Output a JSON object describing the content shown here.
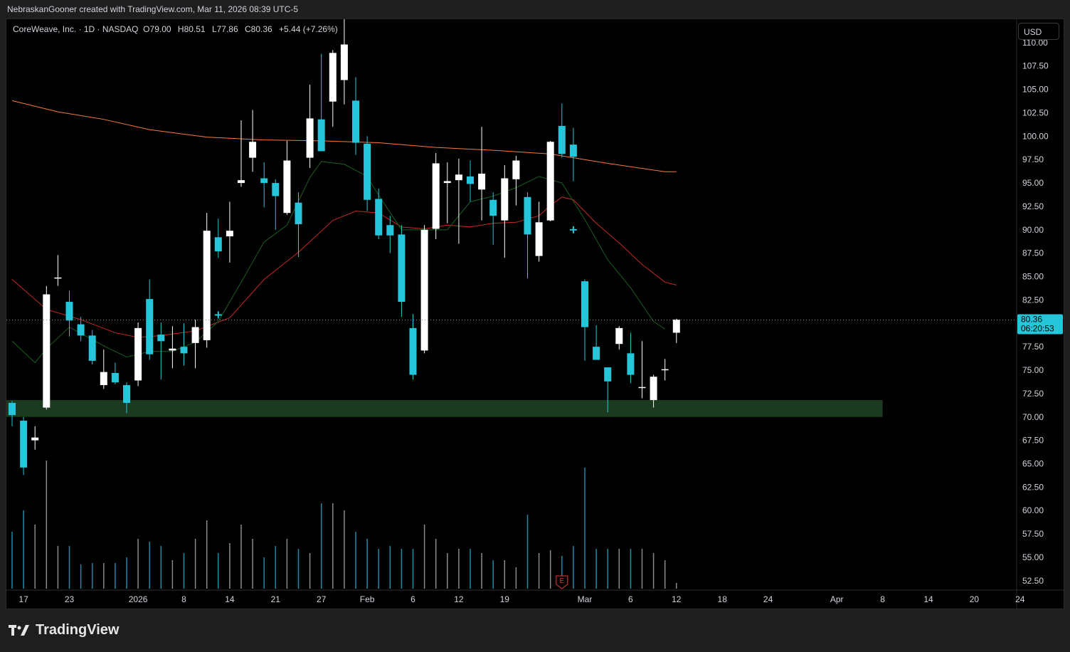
{
  "header": {
    "attribution": "NebraskanGooner created with TradingView.com, Mar 11, 2026 08:39 UTC-5"
  },
  "legend": {
    "symbol": "CoreWeave, Inc. · 1D · NASDAQ",
    "open_label": "O",
    "open": "79.00",
    "high_label": "H",
    "high": "80.51",
    "low_label": "L",
    "low": "77.86",
    "close_label": "C",
    "close": "80.36",
    "change": "+5.44 (+7.26%)"
  },
  "currency": "USD",
  "price_tag": {
    "price": "80.36",
    "countdown": "06:20:53"
  },
  "footer": {
    "brand": "TradingView"
  },
  "colors": {
    "up": "#ffffff",
    "down": "#26c6da",
    "ma_long": "#f57c3a",
    "ma_mid": "#c62828",
    "ma_short": "#1b5e20",
    "zone": "#1b3a1f"
  },
  "chart_data": {
    "type": "candlestick",
    "ylim": [
      51.5,
      112.5
    ],
    "y_ticks": [
      "110.00",
      "107.50",
      "105.00",
      "102.50",
      "100.00",
      "97.50",
      "95.00",
      "92.50",
      "90.00",
      "87.50",
      "85.00",
      "82.50",
      "80.00",
      "77.50",
      "75.00",
      "72.50",
      "70.00",
      "67.50",
      "65.00",
      "62.50",
      "60.00",
      "57.50",
      "55.00",
      "52.50"
    ],
    "x_ticks": [
      {
        "label": "17",
        "i": 1
      },
      {
        "label": "23",
        "i": 5
      },
      {
        "label": "2026",
        "i": 11
      },
      {
        "label": "8",
        "i": 15
      },
      {
        "label": "14",
        "i": 19
      },
      {
        "label": "21",
        "i": 23
      },
      {
        "label": "27",
        "i": 27
      },
      {
        "label": "Feb",
        "i": 31
      },
      {
        "label": "6",
        "i": 35
      },
      {
        "label": "12",
        "i": 39
      },
      {
        "label": "19",
        "i": 43
      },
      {
        "label": "Mar",
        "i": 50
      },
      {
        "label": "6",
        "i": 54
      },
      {
        "label": "12",
        "i": 58
      },
      {
        "label": "18",
        "i": 62
      },
      {
        "label": "24",
        "i": 66
      },
      {
        "label": "Apr",
        "i": 72
      },
      {
        "label": "8",
        "i": 76
      },
      {
        "label": "14",
        "i": 80
      },
      {
        "label": "20",
        "i": 84
      },
      {
        "label": "24",
        "i": 88
      }
    ],
    "candles": [
      {
        "o": 71.5,
        "h": 71.7,
        "l": 69.0,
        "c": 70.2,
        "v": 0.4
      },
      {
        "o": 69.6,
        "h": 70.0,
        "l": 63.8,
        "c": 64.6,
        "v": 0.55
      },
      {
        "o": 67.5,
        "h": 69.0,
        "l": 66.5,
        "c": 67.8,
        "v": 0.45
      },
      {
        "o": 71.0,
        "h": 84.0,
        "l": 70.8,
        "c": 83.1,
        "v": 0.9
      },
      {
        "o": 84.8,
        "h": 87.3,
        "l": 84.0,
        "c": 84.9,
        "v": 0.3
      },
      {
        "o": 82.3,
        "h": 83.5,
        "l": 78.6,
        "c": 80.3,
        "v": 0.3
      },
      {
        "o": 79.9,
        "h": 80.7,
        "l": 78.1,
        "c": 78.7,
        "v": 0.17
      },
      {
        "o": 78.7,
        "h": 79.3,
        "l": 75.6,
        "c": 76.0,
        "v": 0.18
      },
      {
        "o": 73.4,
        "h": 77.2,
        "l": 73.0,
        "c": 74.8,
        "v": 0.18
      },
      {
        "o": 74.7,
        "h": 75.8,
        "l": 73.5,
        "c": 73.7,
        "v": 0.18
      },
      {
        "o": 73.4,
        "h": 73.7,
        "l": 70.4,
        "c": 71.5,
        "v": 0.22
      },
      {
        "o": 73.9,
        "h": 80.1,
        "l": 73.3,
        "c": 79.5,
        "v": 0.35
      },
      {
        "o": 82.6,
        "h": 84.7,
        "l": 76.1,
        "c": 76.7,
        "v": 0.33
      },
      {
        "o": 78.8,
        "h": 80.1,
        "l": 74.0,
        "c": 78.1,
        "v": 0.3
      },
      {
        "o": 77.1,
        "h": 79.7,
        "l": 75.2,
        "c": 77.3,
        "v": 0.2
      },
      {
        "o": 77.5,
        "h": 80.0,
        "l": 75.5,
        "c": 76.8,
        "v": 0.25
      },
      {
        "o": 77.9,
        "h": 80.4,
        "l": 75.2,
        "c": 79.6,
        "v": 0.35
      },
      {
        "o": 78.2,
        "h": 91.8,
        "l": 77.4,
        "c": 89.9,
        "v": 0.48
      },
      {
        "o": 89.2,
        "h": 91.2,
        "l": 87.0,
        "c": 87.7,
        "v": 0.25
      },
      {
        "o": 89.3,
        "h": 93.0,
        "l": 86.5,
        "c": 89.9,
        "v": 0.32
      },
      {
        "o": 95.0,
        "h": 101.7,
        "l": 94.6,
        "c": 95.3,
        "v": 0.45
      },
      {
        "o": 97.7,
        "h": 102.8,
        "l": 96.2,
        "c": 99.4,
        "v": 0.35
      },
      {
        "o": 95.5,
        "h": 97.2,
        "l": 92.4,
        "c": 95.0,
        "v": 0.22
      },
      {
        "o": 95.0,
        "h": 95.4,
        "l": 90.0,
        "c": 93.6,
        "v": 0.3
      },
      {
        "o": 91.8,
        "h": 99.5,
        "l": 91.6,
        "c": 97.4,
        "v": 0.35
      },
      {
        "o": 92.9,
        "h": 94.0,
        "l": 87.1,
        "c": 90.6,
        "v": 0.28
      },
      {
        "o": 97.7,
        "h": 105.5,
        "l": 96.6,
        "c": 101.9,
        "v": 0.25
      },
      {
        "o": 101.8,
        "h": 108.8,
        "l": 98.4,
        "c": 98.4,
        "v": 0.6
      },
      {
        "o": 103.7,
        "h": 109.2,
        "l": 101.0,
        "c": 108.9,
        "v": 0.6
      },
      {
        "o": 106.0,
        "h": 115.0,
        "l": 103.4,
        "c": 109.8,
        "v": 0.55
      },
      {
        "o": 103.8,
        "h": 106.3,
        "l": 98.0,
        "c": 99.3,
        "v": 0.4
      },
      {
        "o": 99.2,
        "h": 100.0,
        "l": 92.0,
        "c": 93.2,
        "v": 0.35
      },
      {
        "o": 93.3,
        "h": 94.4,
        "l": 89.0,
        "c": 89.4,
        "v": 0.28
      },
      {
        "o": 90.5,
        "h": 91.5,
        "l": 87.5,
        "c": 89.4,
        "v": 0.3
      },
      {
        "o": 89.5,
        "h": 90.5,
        "l": 80.7,
        "c": 82.3,
        "v": 0.28
      },
      {
        "o": 79.5,
        "h": 81.0,
        "l": 74.0,
        "c": 74.5,
        "v": 0.28
      },
      {
        "o": 77.1,
        "h": 90.5,
        "l": 76.8,
        "c": 90.0,
        "v": 0.45
      },
      {
        "o": 90.1,
        "h": 98.2,
        "l": 89.0,
        "c": 97.1,
        "v": 0.35
      },
      {
        "o": 95.0,
        "h": 97.2,
        "l": 90.7,
        "c": 95.2,
        "v": 0.25
      },
      {
        "o": 95.3,
        "h": 97.6,
        "l": 88.5,
        "c": 95.9,
        "v": 0.28
      },
      {
        "o": 95.7,
        "h": 97.4,
        "l": 93.0,
        "c": 94.9,
        "v": 0.28
      },
      {
        "o": 94.3,
        "h": 101.0,
        "l": 91.0,
        "c": 96.0,
        "v": 0.25
      },
      {
        "o": 93.2,
        "h": 94.0,
        "l": 88.4,
        "c": 91.5,
        "v": 0.2
      },
      {
        "o": 91.0,
        "h": 96.9,
        "l": 87.0,
        "c": 95.5,
        "v": 0.2
      },
      {
        "o": 95.4,
        "h": 97.9,
        "l": 92.6,
        "c": 97.4,
        "v": 0.15
      },
      {
        "o": 93.5,
        "h": 94.0,
        "l": 84.8,
        "c": 89.5,
        "v": 0.52
      },
      {
        "o": 87.2,
        "h": 93.0,
        "l": 86.6,
        "c": 90.8,
        "v": 0.25
      },
      {
        "o": 91.0,
        "h": 99.5,
        "l": 90.9,
        "c": 99.4,
        "v": 0.27
      },
      {
        "o": 101.1,
        "h": 103.5,
        "l": 97.7,
        "c": 98.1,
        "v": 0.23
      },
      {
        "o": 99.1,
        "h": 100.9,
        "l": 95.2,
        "c": 97.8,
        "v": 0.3
      },
      {
        "o": 84.5,
        "h": 84.7,
        "l": 76.0,
        "c": 79.6,
        "v": 0.85
      },
      {
        "o": 77.5,
        "h": 79.8,
        "l": 76.2,
        "c": 76.1,
        "v": 0.28
      },
      {
        "o": 75.3,
        "h": 75.3,
        "l": 70.5,
        "c": 73.8,
        "v": 0.28
      },
      {
        "o": 77.8,
        "h": 79.7,
        "l": 77.2,
        "c": 79.5,
        "v": 0.28
      },
      {
        "o": 76.8,
        "h": 79.0,
        "l": 73.6,
        "c": 74.5,
        "v": 0.28
      },
      {
        "o": 73.2,
        "h": 78.1,
        "l": 72.0,
        "c": 73.2,
        "v": 0.28
      },
      {
        "o": 71.8,
        "h": 74.5,
        "l": 71.0,
        "c": 74.3,
        "v": 0.25
      },
      {
        "o": 75.0,
        "h": 76.2,
        "l": 73.9,
        "c": 75.1,
        "v": 0.2
      },
      {
        "o": 79.0,
        "h": 80.5,
        "l": 77.9,
        "c": 80.4,
        "v": 0.04
      }
    ],
    "ma_long": [
      [
        0,
        103.8
      ],
      [
        4,
        102.6
      ],
      [
        8,
        101.8
      ],
      [
        12,
        100.7
      ],
      [
        17,
        99.9
      ],
      [
        22,
        99.6
      ],
      [
        27,
        99.5
      ],
      [
        32,
        99.3
      ],
      [
        37,
        98.8
      ],
      [
        42,
        98.5
      ],
      [
        47,
        98.1
      ],
      [
        52,
        97.1
      ],
      [
        57,
        96.2
      ],
      [
        58,
        96.2
      ]
    ],
    "ma_mid": [
      [
        0,
        84.7
      ],
      [
        3,
        81.5
      ],
      [
        6,
        80.4
      ],
      [
        9,
        79.0
      ],
      [
        11,
        78.5
      ],
      [
        13,
        78.7
      ],
      [
        16,
        79.2
      ],
      [
        19,
        80.6
      ],
      [
        22,
        84.7
      ],
      [
        25,
        87.6
      ],
      [
        28,
        91.0
      ],
      [
        30,
        92.0
      ],
      [
        32,
        91.8
      ],
      [
        34,
        90.3
      ],
      [
        36,
        90.1
      ],
      [
        38,
        90.5
      ],
      [
        40,
        90.3
      ],
      [
        42,
        90.7
      ],
      [
        44,
        90.8
      ],
      [
        46,
        91.5
      ],
      [
        47,
        92.6
      ],
      [
        48,
        93.5
      ],
      [
        49,
        93.2
      ],
      [
        51,
        90.7
      ],
      [
        53,
        88.6
      ],
      [
        55,
        86.3
      ],
      [
        57,
        84.4
      ],
      [
        58,
        84.1
      ]
    ],
    "ma_short": [
      [
        0,
        78.1
      ],
      [
        2,
        75.8
      ],
      [
        3,
        77.3
      ],
      [
        5,
        79.6
      ],
      [
        8,
        77.6
      ],
      [
        10,
        76.4
      ],
      [
        12,
        77.0
      ],
      [
        14,
        77.0
      ],
      [
        16,
        78.0
      ],
      [
        18,
        80.2
      ],
      [
        20,
        84.4
      ],
      [
        22,
        88.7
      ],
      [
        24,
        90.5
      ],
      [
        26,
        95.6
      ],
      [
        27,
        97.3
      ],
      [
        29,
        97.0
      ],
      [
        31,
        95.7
      ],
      [
        32,
        93.7
      ],
      [
        34,
        90.0
      ],
      [
        36,
        90.0
      ],
      [
        38,
        90.0
      ],
      [
        40,
        93.0
      ],
      [
        42,
        93.6
      ],
      [
        44,
        94.5
      ],
      [
        46,
        95.7
      ],
      [
        48,
        95.0
      ],
      [
        50,
        91.1
      ],
      [
        52,
        86.8
      ],
      [
        54,
        83.8
      ],
      [
        56,
        80.2
      ],
      [
        57,
        79.4
      ]
    ],
    "support_zone": {
      "y_low": 70.0,
      "y_high": 71.8,
      "i_start": 0,
      "i_end": 76
    },
    "crosses": [
      [
        18,
        80.9
      ],
      [
        49,
        90.0
      ]
    ],
    "earnings_marker": {
      "i": 48,
      "label": "E"
    },
    "last_price": 80.36
  }
}
